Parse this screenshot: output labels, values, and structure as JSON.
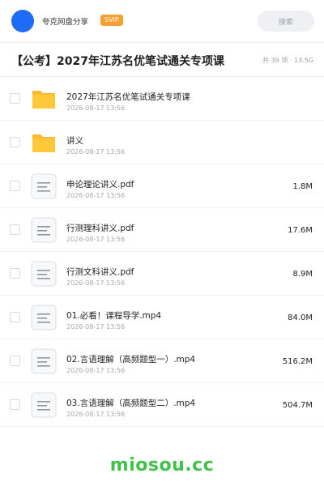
{
  "header": {
    "app_name": "夸克网盘分享",
    "badge": "SVIP",
    "search_placeholder": "搜索",
    "avatar_color": "#1e6cf6"
  },
  "folder": {
    "title": "【公考】2027年江苏名优笔试通关专项课",
    "meta": "共 39 项 · 13.5G"
  },
  "items": [
    {
      "name": "2027年江苏名优笔试通关专项课",
      "date": "2026-08-17 13:56",
      "size": "",
      "type": "folder",
      "icon": "folder-icon"
    },
    {
      "name": "讲义",
      "date": "2026-08-17 13:56",
      "size": "",
      "type": "folder",
      "icon": "folder-icon"
    },
    {
      "name": "申论理论讲义.pdf",
      "date": "2026-08-17 13:56",
      "size": "1.8M",
      "type": "file",
      "icon": "document-icon"
    },
    {
      "name": "行测理科讲义.pdf",
      "date": "2026-08-17 13:56",
      "size": "17.6M",
      "type": "file",
      "icon": "document-icon"
    },
    {
      "name": "行测文科讲义.pdf",
      "date": "2026-08-17 13:56",
      "size": "8.9M",
      "type": "file",
      "icon": "document-icon"
    },
    {
      "name": "01.必看！课程导学.mp4",
      "date": "2026-08-17 13:56",
      "size": "84.0M",
      "type": "file",
      "icon": "document-icon"
    },
    {
      "name": "02.言语理解（高频题型一）.mp4",
      "date": "2026-08-17 13:56",
      "size": "516.2M",
      "type": "file",
      "icon": "document-icon"
    },
    {
      "name": "03.言语理解（高频题型二）.mp4",
      "date": "2026-08-17 13:56",
      "size": "504.7M",
      "type": "file",
      "icon": "document-icon"
    }
  ],
  "watermark": "miosou.cc",
  "colors": {
    "accent": "#1e6cf6",
    "svip": "#f6a031",
    "folder": "#fdc93a",
    "watermark": "#3fc14a"
  }
}
